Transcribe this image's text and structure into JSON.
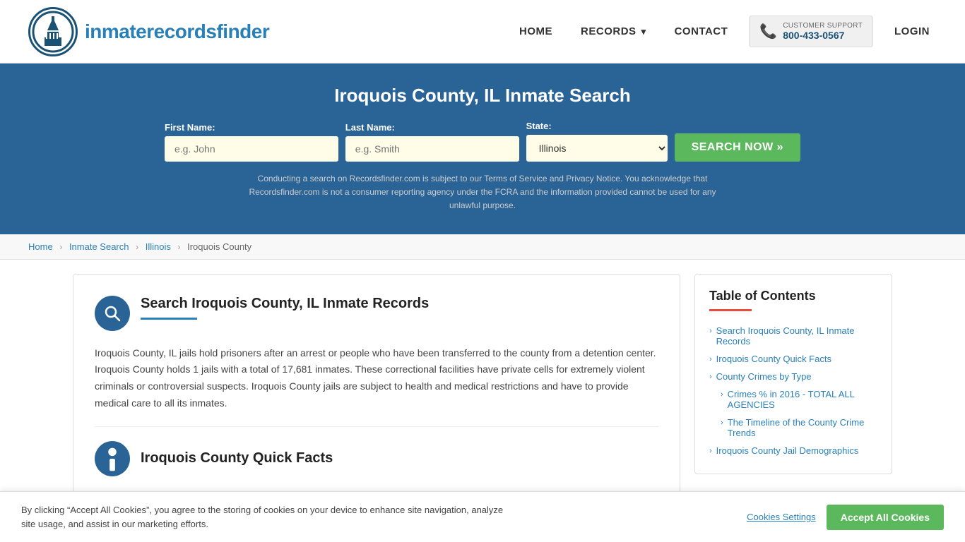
{
  "site": {
    "logo_text_normal": "inmaterecords",
    "logo_text_bold": "finder"
  },
  "nav": {
    "home_label": "HOME",
    "records_label": "RECORDS",
    "contact_label": "CONTACT",
    "support_label": "CUSTOMER SUPPORT",
    "support_number": "800-433-0567",
    "login_label": "LOGIN"
  },
  "hero": {
    "title": "Iroquois County, IL Inmate Search",
    "first_name_label": "First Name:",
    "first_name_placeholder": "e.g. John",
    "last_name_label": "Last Name:",
    "last_name_placeholder": "e.g. Smith",
    "state_label": "State:",
    "state_value": "Illinois",
    "search_button": "SEARCH NOW »",
    "disclaimer": "Conducting a search on Recordsfinder.com is subject to our Terms of Service and Privacy Notice. You acknowledge that Recordsfinder.com is not a consumer reporting agency under the FCRA and the information provided cannot be used for any unlawful purpose."
  },
  "breadcrumb": {
    "home": "Home",
    "inmate_search": "Inmate Search",
    "illinois": "Illinois",
    "county": "Iroquois County"
  },
  "main_section": {
    "title": "Search Iroquois County, IL Inmate Records",
    "body": "Iroquois County, IL jails hold prisoners after an arrest or people who have been transferred to the county from a detention center. Iroquois County holds 1 jails with a total of 17,681 inmates. These correctional facilities have private cells for extremely violent criminals or controversial suspects. Iroquois County jails are subject to health and medical restrictions and have to provide medical care to all its inmates."
  },
  "quick_facts": {
    "title": "Iroquois County Quick Facts"
  },
  "toc": {
    "title": "Table of Contents",
    "items": [
      {
        "label": "Search Iroquois County, IL Inmate Records",
        "sub": false
      },
      {
        "label": "Iroquois County Quick Facts",
        "sub": false
      },
      {
        "label": "County Crimes by Type",
        "sub": false
      },
      {
        "label": "Crimes % in 2016 - TOTAL ALL AGENCIES",
        "sub": true
      },
      {
        "label": "The Timeline of the County Crime Trends",
        "sub": true
      },
      {
        "label": "Iroquois County Jail Demographics",
        "sub": false
      }
    ]
  },
  "cookie_banner": {
    "text": "By clicking “Accept All Cookies”, you agree to the storing of cookies on your device to enhance site navigation, analyze site usage, and assist in our marketing efforts.",
    "settings_label": "Cookies Settings",
    "accept_label": "Accept All Cookies"
  }
}
